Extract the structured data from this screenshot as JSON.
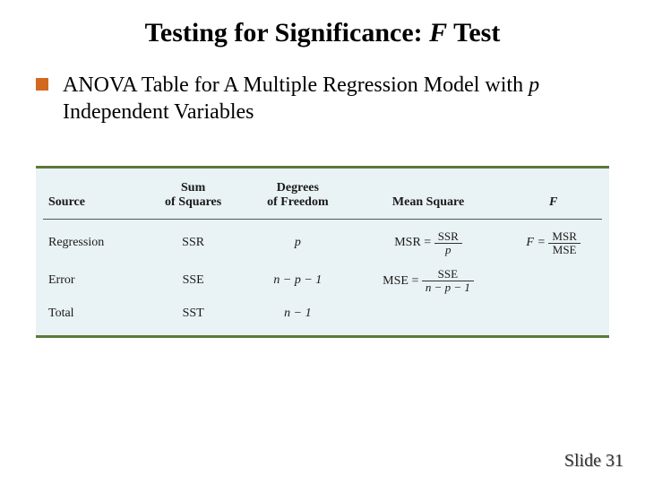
{
  "title_plain": "Testing for Significance:  ",
  "title_italic": "F",
  "title_tail": "  Test",
  "bullet": {
    "lead": "ANOVA Table for A Multiple Regression Model with ",
    "p": "p",
    "tail": " Independent Variables"
  },
  "table": {
    "headers": {
      "source": "Source",
      "sos_l1": "Sum",
      "sos_l2": "of Squares",
      "dof_l1": "Degrees",
      "dof_l2": "of Freedom",
      "ms": "Mean Square",
      "F": "F"
    },
    "rows": {
      "regression": {
        "source": "Regression",
        "sos": "SSR",
        "dof": "p",
        "ms_lhs": "MSR =",
        "ms_num": "SSR",
        "ms_den": "p",
        "F_lhs": "F =",
        "F_num": "MSR",
        "F_den": "MSE"
      },
      "error": {
        "source": "Error",
        "sos": "SSE",
        "dof": "n − p − 1",
        "ms_lhs": "MSE =",
        "ms_num": "SSE",
        "ms_den": "n − p − 1"
      },
      "total": {
        "source": "Total",
        "sos": "SST",
        "dof": "n − 1"
      }
    }
  },
  "footer": {
    "label": "Slide",
    "num": "31"
  },
  "chart_data": {
    "type": "table",
    "title": "ANOVA Table for A Multiple Regression Model with p Independent Variables",
    "columns": [
      "Source",
      "Sum of Squares",
      "Degrees of Freedom",
      "Mean Square",
      "F"
    ],
    "rows": [
      [
        "Regression",
        "SSR",
        "p",
        "MSR = SSR / p",
        "F = MSR / MSE"
      ],
      [
        "Error",
        "SSE",
        "n − p − 1",
        "MSE = SSE / (n − p − 1)",
        ""
      ],
      [
        "Total",
        "SST",
        "n − 1",
        "",
        ""
      ]
    ]
  }
}
